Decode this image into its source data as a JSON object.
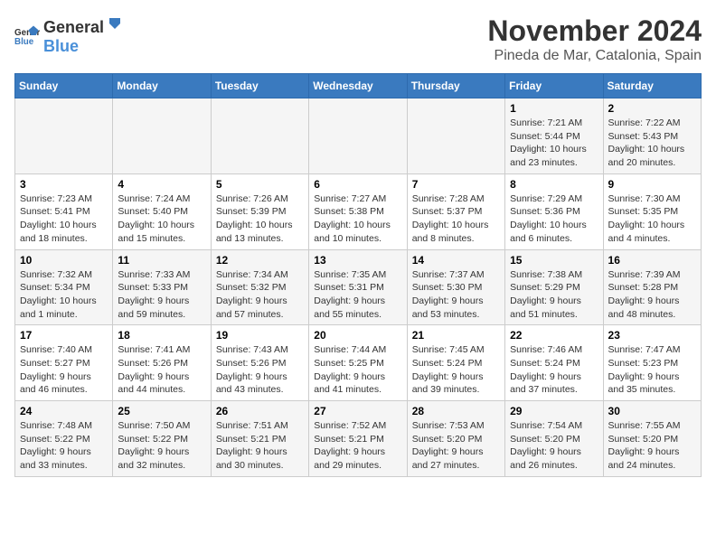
{
  "header": {
    "logo_general": "General",
    "logo_blue": "Blue",
    "title": "November 2024",
    "subtitle": "Pineda de Mar, Catalonia, Spain"
  },
  "days_of_week": [
    "Sunday",
    "Monday",
    "Tuesday",
    "Wednesday",
    "Thursday",
    "Friday",
    "Saturday"
  ],
  "weeks": [
    [
      {
        "day": "",
        "info": ""
      },
      {
        "day": "",
        "info": ""
      },
      {
        "day": "",
        "info": ""
      },
      {
        "day": "",
        "info": ""
      },
      {
        "day": "",
        "info": ""
      },
      {
        "day": "1",
        "info": "Sunrise: 7:21 AM\nSunset: 5:44 PM\nDaylight: 10 hours and 23 minutes."
      },
      {
        "day": "2",
        "info": "Sunrise: 7:22 AM\nSunset: 5:43 PM\nDaylight: 10 hours and 20 minutes."
      }
    ],
    [
      {
        "day": "3",
        "info": "Sunrise: 7:23 AM\nSunset: 5:41 PM\nDaylight: 10 hours and 18 minutes."
      },
      {
        "day": "4",
        "info": "Sunrise: 7:24 AM\nSunset: 5:40 PM\nDaylight: 10 hours and 15 minutes."
      },
      {
        "day": "5",
        "info": "Sunrise: 7:26 AM\nSunset: 5:39 PM\nDaylight: 10 hours and 13 minutes."
      },
      {
        "day": "6",
        "info": "Sunrise: 7:27 AM\nSunset: 5:38 PM\nDaylight: 10 hours and 10 minutes."
      },
      {
        "day": "7",
        "info": "Sunrise: 7:28 AM\nSunset: 5:37 PM\nDaylight: 10 hours and 8 minutes."
      },
      {
        "day": "8",
        "info": "Sunrise: 7:29 AM\nSunset: 5:36 PM\nDaylight: 10 hours and 6 minutes."
      },
      {
        "day": "9",
        "info": "Sunrise: 7:30 AM\nSunset: 5:35 PM\nDaylight: 10 hours and 4 minutes."
      }
    ],
    [
      {
        "day": "10",
        "info": "Sunrise: 7:32 AM\nSunset: 5:34 PM\nDaylight: 10 hours and 1 minute."
      },
      {
        "day": "11",
        "info": "Sunrise: 7:33 AM\nSunset: 5:33 PM\nDaylight: 9 hours and 59 minutes."
      },
      {
        "day": "12",
        "info": "Sunrise: 7:34 AM\nSunset: 5:32 PM\nDaylight: 9 hours and 57 minutes."
      },
      {
        "day": "13",
        "info": "Sunrise: 7:35 AM\nSunset: 5:31 PM\nDaylight: 9 hours and 55 minutes."
      },
      {
        "day": "14",
        "info": "Sunrise: 7:37 AM\nSunset: 5:30 PM\nDaylight: 9 hours and 53 minutes."
      },
      {
        "day": "15",
        "info": "Sunrise: 7:38 AM\nSunset: 5:29 PM\nDaylight: 9 hours and 51 minutes."
      },
      {
        "day": "16",
        "info": "Sunrise: 7:39 AM\nSunset: 5:28 PM\nDaylight: 9 hours and 48 minutes."
      }
    ],
    [
      {
        "day": "17",
        "info": "Sunrise: 7:40 AM\nSunset: 5:27 PM\nDaylight: 9 hours and 46 minutes."
      },
      {
        "day": "18",
        "info": "Sunrise: 7:41 AM\nSunset: 5:26 PM\nDaylight: 9 hours and 44 minutes."
      },
      {
        "day": "19",
        "info": "Sunrise: 7:43 AM\nSunset: 5:26 PM\nDaylight: 9 hours and 43 minutes."
      },
      {
        "day": "20",
        "info": "Sunrise: 7:44 AM\nSunset: 5:25 PM\nDaylight: 9 hours and 41 minutes."
      },
      {
        "day": "21",
        "info": "Sunrise: 7:45 AM\nSunset: 5:24 PM\nDaylight: 9 hours and 39 minutes."
      },
      {
        "day": "22",
        "info": "Sunrise: 7:46 AM\nSunset: 5:24 PM\nDaylight: 9 hours and 37 minutes."
      },
      {
        "day": "23",
        "info": "Sunrise: 7:47 AM\nSunset: 5:23 PM\nDaylight: 9 hours and 35 minutes."
      }
    ],
    [
      {
        "day": "24",
        "info": "Sunrise: 7:48 AM\nSunset: 5:22 PM\nDaylight: 9 hours and 33 minutes."
      },
      {
        "day": "25",
        "info": "Sunrise: 7:50 AM\nSunset: 5:22 PM\nDaylight: 9 hours and 32 minutes."
      },
      {
        "day": "26",
        "info": "Sunrise: 7:51 AM\nSunset: 5:21 PM\nDaylight: 9 hours and 30 minutes."
      },
      {
        "day": "27",
        "info": "Sunrise: 7:52 AM\nSunset: 5:21 PM\nDaylight: 9 hours and 29 minutes."
      },
      {
        "day": "28",
        "info": "Sunrise: 7:53 AM\nSunset: 5:20 PM\nDaylight: 9 hours and 27 minutes."
      },
      {
        "day": "29",
        "info": "Sunrise: 7:54 AM\nSunset: 5:20 PM\nDaylight: 9 hours and 26 minutes."
      },
      {
        "day": "30",
        "info": "Sunrise: 7:55 AM\nSunset: 5:20 PM\nDaylight: 9 hours and 24 minutes."
      }
    ]
  ]
}
